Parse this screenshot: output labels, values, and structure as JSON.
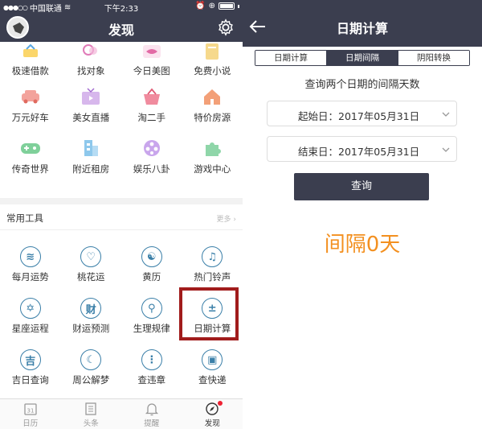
{
  "left": {
    "status": {
      "carrier": "中国联通",
      "time": "下午2:33"
    },
    "title": "发现",
    "top_row_labels": [
      "极速借款",
      "找对象",
      "今日美图",
      "免费小说"
    ],
    "row2_labels": [
      "万元好车",
      "美女直播",
      "淘二手",
      "特价房源"
    ],
    "row3_labels": [
      "传奇世界",
      "附近租房",
      "娱乐八卦",
      "游戏中心"
    ],
    "tools": {
      "title": "常用工具",
      "more": "更多 ›",
      "items": [
        {
          "label": "每月运势",
          "icon": "coin-icon",
          "glyph": "≋"
        },
        {
          "label": "桃花运",
          "icon": "heart-icon",
          "glyph": "♡"
        },
        {
          "label": "黄历",
          "icon": "yinyang-icon",
          "glyph": "☯"
        },
        {
          "label": "热门铃声",
          "icon": "music-icon",
          "glyph": "♫"
        },
        {
          "label": "星座运程",
          "icon": "star-icon",
          "glyph": "✡"
        },
        {
          "label": "财运预测",
          "icon": "wealth-icon",
          "glyph": "财"
        },
        {
          "label": "生理规律",
          "icon": "magnifier-icon",
          "glyph": "⚲"
        },
        {
          "label": "日期计算",
          "icon": "calculator-icon",
          "glyph": "±"
        },
        {
          "label": "吉日查询",
          "icon": "lucky-day-icon",
          "glyph": "吉"
        },
        {
          "label": "周公解梦",
          "icon": "moon-icon",
          "glyph": "☾"
        },
        {
          "label": "查违章",
          "icon": "traffic-light-icon",
          "glyph": "⋮"
        },
        {
          "label": "查快递",
          "icon": "delivery-icon",
          "glyph": "▣"
        }
      ]
    },
    "tabbar": [
      {
        "label": "日历",
        "badge": "31"
      },
      {
        "label": "头条"
      },
      {
        "label": "提醒"
      },
      {
        "label": "发现"
      }
    ],
    "colors": {
      "header": "#3b3e4f",
      "highlight": "#a11c1c",
      "tool_icon": "#3a7fa8",
      "badge": "#e22233"
    }
  },
  "right": {
    "title": "日期计算",
    "segments": [
      "日期计算",
      "日期间隔",
      "阴阳转换"
    ],
    "active_segment": "日期间隔",
    "subtitle": "查询两个日期的间隔天数",
    "start_label": "起始日：2017年05月31日",
    "end_label": "结束日：2017年05月31日",
    "query_button": "查询",
    "result": "间隔0天",
    "colors": {
      "result": "#f39020"
    }
  }
}
